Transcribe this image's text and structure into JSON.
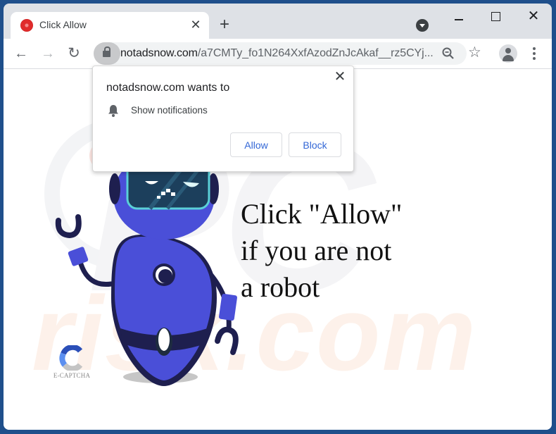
{
  "browser": {
    "tab": {
      "title": "Click Allow",
      "favicon": "red-circle-favicon",
      "close_glyph": "✕"
    },
    "new_tab_glyph": "+",
    "window_controls": {
      "minimize": "minimize",
      "maximize": "maximize",
      "close_glyph": "✕"
    },
    "nav": {
      "back_glyph": "←",
      "forward_glyph": "→",
      "reload_glyph": "↻"
    },
    "address_bar": {
      "domain": "notadsnow.com",
      "path": "/a7CMTy_fo1N264XxfAzodZnJcAkaf__rz5CYj..."
    },
    "star_glyph": "☆"
  },
  "permission_popup": {
    "title": "notadsnow.com wants to",
    "permission": "Show notifications",
    "close_glyph": "✕",
    "allow_label": "Allow",
    "block_label": "Block"
  },
  "page": {
    "headline": [
      "Click \"Allow\"",
      "if you are not",
      "a robot"
    ],
    "captcha_label": "E-CAPTCHA",
    "watermark": {
      "top": "PC",
      "bottom": "risk.com"
    }
  },
  "colors": {
    "desktop": "#1f4f8b",
    "chrome_frame": "#dee1e6",
    "button_text": "#3367d6",
    "robot_body": "#4a4fd8",
    "robot_dark": "#1e1f4f"
  }
}
